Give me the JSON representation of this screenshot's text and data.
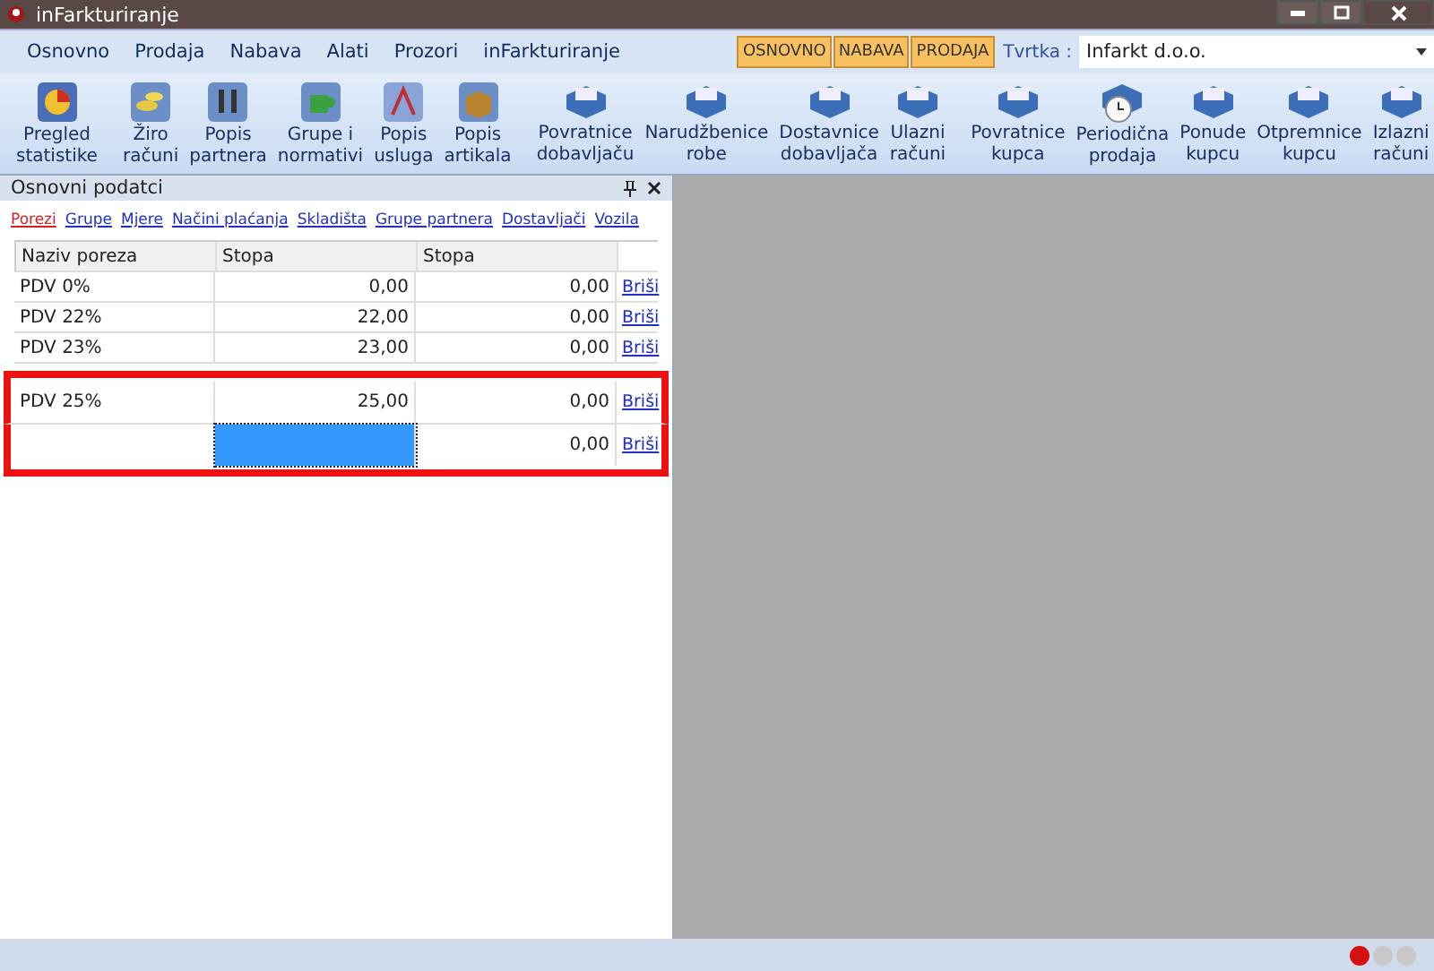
{
  "window": {
    "title": "inFarkturiranje"
  },
  "menu": [
    "Osnovno",
    "Prodaja",
    "Nabava",
    "Alati",
    "Prozori",
    "inFarkturiranje"
  ],
  "modules": [
    {
      "label": "OSNOVNO"
    },
    {
      "label": "NABAVA"
    },
    {
      "label": "PRODAJA"
    }
  ],
  "company": {
    "label": "Tvrtka :",
    "value": "Infarkt d.o.o."
  },
  "toolbar_groups": [
    [
      {
        "kind": "pie",
        "lines": [
          "Pregled",
          "statistike"
        ]
      }
    ],
    [
      {
        "kind": "coins",
        "lines": [
          "Žiro",
          "računi"
        ]
      },
      {
        "kind": "people",
        "lines": [
          "Popis",
          "partnera"
        ]
      },
      {
        "kind": "puzzle",
        "lines": [
          "Grupe i",
          "normativi"
        ]
      },
      {
        "kind": "pen",
        "lines": [
          "Popis",
          "usluga"
        ]
      },
      {
        "kind": "box",
        "lines": [
          "Popis",
          "artikala"
        ]
      }
    ],
    [
      {
        "kind": "tray",
        "lines": [
          "Povratnice",
          "dobavljaču"
        ]
      },
      {
        "kind": "tray",
        "lines": [
          "Narudžbenice",
          "robe"
        ]
      },
      {
        "kind": "tray",
        "lines": [
          "Dostavnice",
          "dobavljača"
        ]
      },
      {
        "kind": "tray",
        "lines": [
          "Ulazni",
          "računi"
        ]
      }
    ],
    [
      {
        "kind": "tray",
        "lines": [
          "Povratnice",
          "kupca"
        ]
      },
      {
        "kind": "clock",
        "lines": [
          "Periodična",
          "prodaja"
        ]
      },
      {
        "kind": "tray",
        "lines": [
          "Ponude",
          "kupcu"
        ]
      },
      {
        "kind": "tray",
        "lines": [
          "Otpremnice",
          "kupcu"
        ]
      },
      {
        "kind": "tray",
        "lines": [
          "Izlazni",
          "računi"
        ]
      }
    ]
  ],
  "panel": {
    "title": "Osnovni podatci",
    "links": [
      {
        "label": "Porezi",
        "selected": true
      },
      {
        "label": "Grupe",
        "selected": false
      },
      {
        "label": "Mjere",
        "selected": false
      },
      {
        "label": "Načini plaćanja",
        "selected": false
      },
      {
        "label": "Skladišta",
        "selected": false
      },
      {
        "label": "Grupe partnera",
        "selected": false
      },
      {
        "label": "Dostavljači",
        "selected": false
      },
      {
        "label": "Vozila",
        "selected": false
      }
    ],
    "table": {
      "columns": [
        "Naziv poreza",
        "Stopa",
        "Stopa"
      ],
      "rows": [
        {
          "cells": [
            {
              "text": "PDV 0%",
              "selected": false
            },
            {
              "text": "0,00",
              "selected": false
            },
            {
              "text": "0,00",
              "selected": false
            }
          ],
          "action": "Briši",
          "highlighted": false
        },
        {
          "cells": [
            {
              "text": "PDV 22%",
              "selected": false
            },
            {
              "text": "22,00",
              "selected": false
            },
            {
              "text": "0,00",
              "selected": false
            }
          ],
          "action": "Briši",
          "highlighted": false
        },
        {
          "cells": [
            {
              "text": "PDV 23%",
              "selected": false
            },
            {
              "text": "23,00",
              "selected": false
            },
            {
              "text": "0,00",
              "selected": false
            }
          ],
          "action": "Briši",
          "highlighted": false
        },
        {
          "cells": [
            {
              "text": "PDV 25%",
              "selected": false
            },
            {
              "text": "25,00",
              "selected": false
            },
            {
              "text": "0,00",
              "selected": false
            }
          ],
          "action": "Briši",
          "highlighted": true
        },
        {
          "cells": [
            {
              "text": "",
              "selected": false
            },
            {
              "text": "",
              "selected": true
            },
            {
              "text": "0,00",
              "selected": false
            }
          ],
          "action": "Briši",
          "highlighted": true
        }
      ]
    }
  }
}
